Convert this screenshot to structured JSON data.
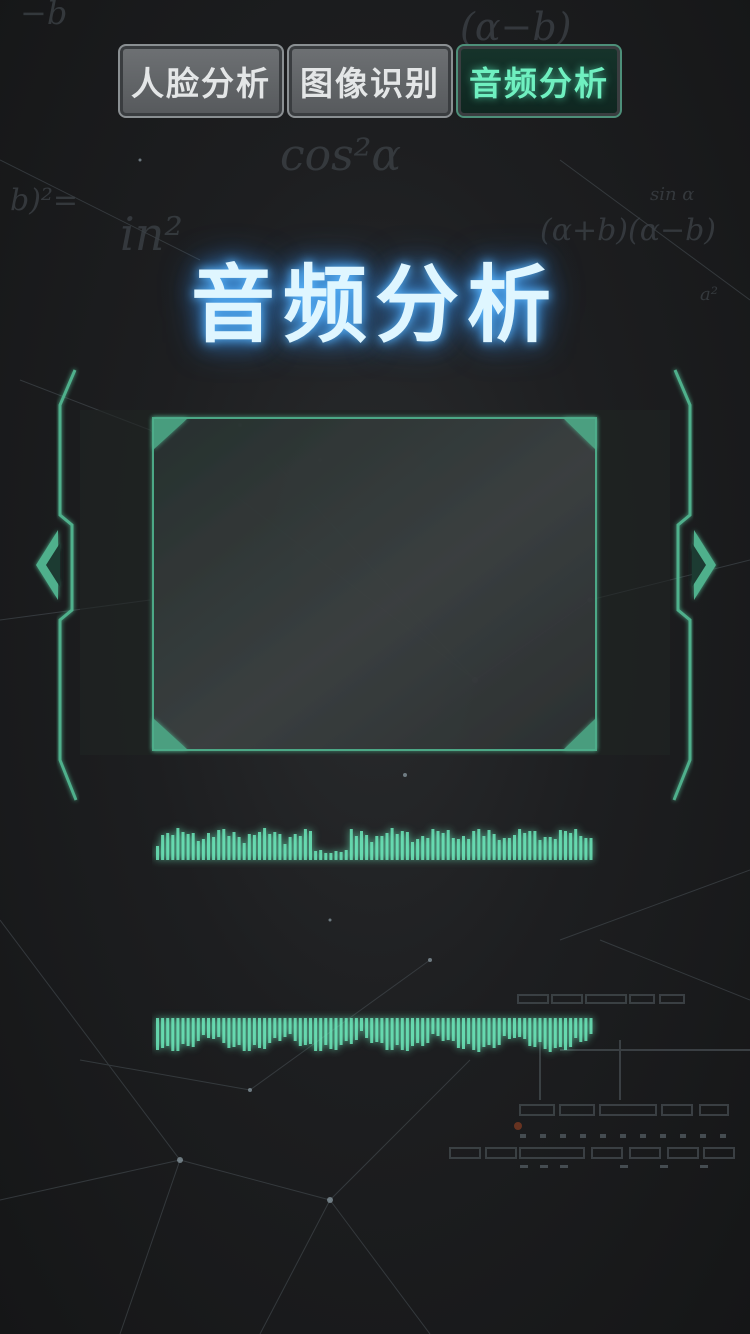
{
  "tabs": [
    {
      "label": "人脸分析",
      "active": false
    },
    {
      "label": "图像识别",
      "active": false
    },
    {
      "label": "音频分析",
      "active": true
    }
  ],
  "page_title": "音频分析",
  "colors": {
    "accent": "#6ff0c0",
    "frame": "#4fb08c",
    "title_glow": "#5bb8ff",
    "background": "#1d1e20"
  },
  "icons": {
    "left_arrow": "chevron-left-icon",
    "right_arrow": "chevron-right-icon"
  }
}
